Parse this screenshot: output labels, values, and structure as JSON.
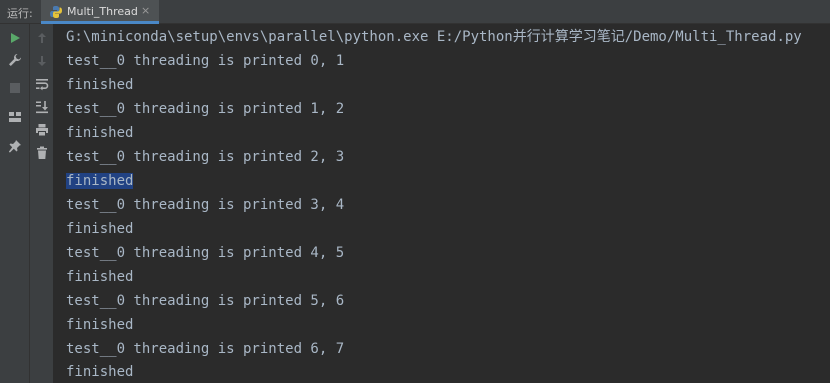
{
  "run_panel": {
    "label": "运行:",
    "tab": {
      "title": "Multi_Thread",
      "close_symbol": "×"
    }
  },
  "toolbar": {
    "left_icons": [
      "run-icon",
      "wrench-icon",
      "stop-icon",
      "layout-icon",
      "pin-icon"
    ],
    "right_icons": [
      "up-arrow-icon",
      "down-arrow-icon",
      "soft-wrap-icon",
      "scroll-to-end-icon",
      "print-icon",
      "trash-icon"
    ]
  },
  "console": {
    "command": "G:\\miniconda\\setup\\envs\\parallel\\python.exe E:/Python并行计算学习笔记/Demo/Multi_Thread.py",
    "lines": [
      "test__0 threading is printed 0, 1",
      "finished",
      "test__0 threading is printed 1, 2",
      "finished",
      "test__0 threading is printed 2, 3",
      "finished",
      "test__0 threading is printed 3, 4",
      "finished",
      "test__0 threading is printed 4, 5",
      "finished",
      "test__0 threading is printed 5, 6",
      "finished",
      "test__0 threading is printed 6, 7",
      "finished"
    ],
    "selected_line_index": 5
  },
  "colors": {
    "background": "#2b2b2b",
    "panel": "#3c3f41",
    "text": "#a9b7c6",
    "selection": "#214283",
    "run_green": "#59a869"
  }
}
